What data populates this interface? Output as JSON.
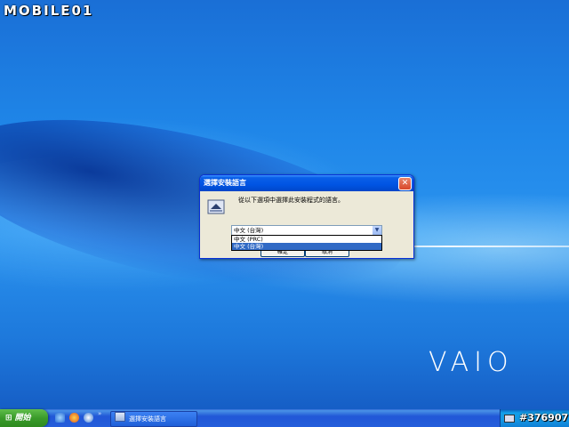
{
  "site_watermark": "MOBILE01",
  "desktop": {
    "brand_logo": "VAIO"
  },
  "dialog": {
    "title": "選擇安裝語言",
    "prompt": "從以下選項中選擇此安裝程式的語言。",
    "language_select": {
      "current_value": "中文 (台灣)",
      "options": [
        "中文 (PRC)",
        "中文 (台灣)"
      ],
      "highlighted_option": "中文 (台灣)"
    },
    "buttons": {
      "ok": "確定",
      "cancel": "取消"
    }
  },
  "taskbar": {
    "start_label": "開始",
    "quick_launch_icons": [
      "ie-icon",
      "firefox-icon",
      "media-player-icon"
    ],
    "task_button_label": "選擇安裝語言",
    "tray_label": "#376907"
  },
  "colors": {
    "titlebar": "#0054e3",
    "dialog_body": "#ece9d8",
    "selection": "#316ac5",
    "start_button": "#3a9b2a",
    "taskbar": "#245edb"
  }
}
